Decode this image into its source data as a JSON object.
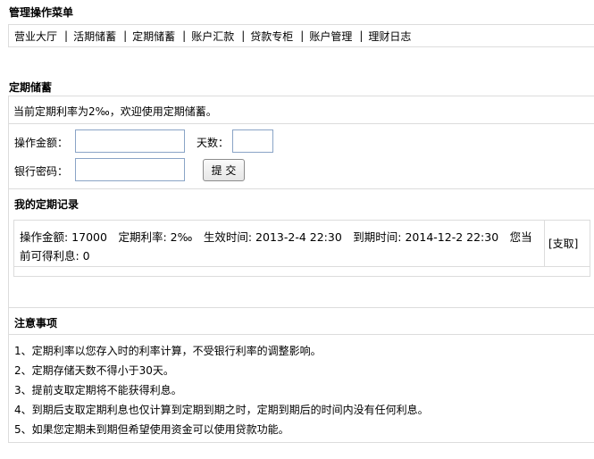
{
  "menu": {
    "title": "管理操作菜单",
    "separator": "|",
    "items": [
      {
        "label": "营业大厅"
      },
      {
        "label": "活期储蓄"
      },
      {
        "label": "定期储蓄"
      },
      {
        "label": "账户汇款"
      },
      {
        "label": "贷款专柜"
      },
      {
        "label": "账户管理"
      },
      {
        "label": "理财日志"
      }
    ]
  },
  "deposit": {
    "title": "定期储蓄",
    "rate_notice": "当前定期利率为2‰，欢迎使用定期储蓄。",
    "amount_label": "操作金额：",
    "amount_value": "",
    "days_label": "天数：",
    "days_value": "",
    "password_label": "银行密码：",
    "password_value": "",
    "submit_label": "提 交"
  },
  "records": {
    "title": "我的定期记录",
    "items": [
      {
        "text": "操作金额: 17000　定期利率: 2‰　生效时间: 2013-2-4 22:30　到期时间: 2014-12-2 22:30　您当前可得利息: 0",
        "action": "[支取]"
      }
    ]
  },
  "notes": {
    "title": "注意事项",
    "items": [
      "1、定期利率以您存入时的利率计算，不受银行利率的调整影响。",
      "2、定期存储天数不得小于30天。",
      "3、提前支取定期将不能获得利息。",
      "4、到期后支取定期利息也仅计算到定期到期之时，定期到期后的时间内没有任何利息。",
      "5、如果您定期未到期但希望使用资金可以使用贷款功能。"
    ]
  }
}
